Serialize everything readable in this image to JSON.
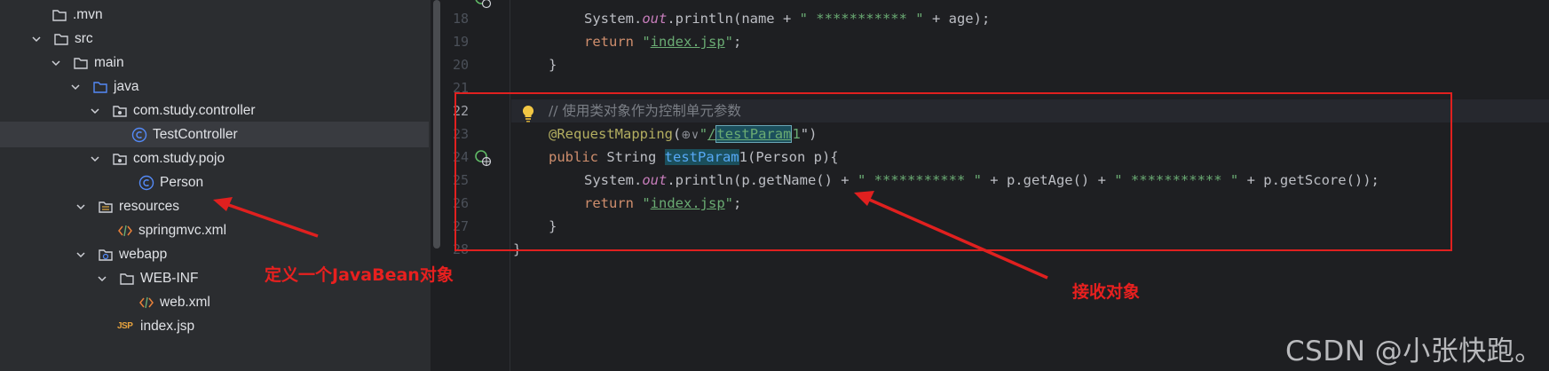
{
  "project_tree": {
    "rows": [
      {
        "label": ".mvn",
        "icon": "folder-icon"
      },
      {
        "label": "src",
        "icon": "folder-icon"
      },
      {
        "label": "main",
        "icon": "folder-icon"
      },
      {
        "label": "java",
        "icon": "source-folder-icon"
      },
      {
        "label": "com.study.controller",
        "icon": "package-icon"
      },
      {
        "label": "TestController",
        "icon": "class-icon"
      },
      {
        "label": "com.study.pojo",
        "icon": "package-icon"
      },
      {
        "label": "Person",
        "icon": "class-icon"
      },
      {
        "label": "resources",
        "icon": "resources-folder-icon"
      },
      {
        "label": "springmvc.xml",
        "icon": "xml-file-icon"
      },
      {
        "label": "webapp",
        "icon": "web-folder-icon"
      },
      {
        "label": "WEB-INF",
        "icon": "folder-icon"
      },
      {
        "label": "web.xml",
        "icon": "xml-file-icon"
      },
      {
        "label": "index.jsp",
        "icon": "jsp-file-icon",
        "badge": "JSP"
      }
    ],
    "selected": "TestController"
  },
  "editor": {
    "line_numbers": [
      "18",
      "19",
      "20",
      "21",
      "22",
      "23",
      "24",
      "25",
      "26",
      "27",
      "28"
    ],
    "active_line": "22",
    "code": {
      "l18": {
        "a": "System.",
        "b": "out",
        "c": ".println(name + ",
        "d": "\" *********** \"",
        "e": " + age);"
      },
      "l19": {
        "a": "return ",
        "b": "\"",
        "c": "index.jsp",
        "d": "\"",
        "e": ";"
      },
      "l20": "}",
      "l22": "// 使用类对象作为控制单元参数",
      "l23": {
        "a": "@RequestMapping",
        "b": "(",
        "c": "⊕∨",
        "d": "\"",
        "e": "/",
        "f": "testParam",
        "g": "1",
        "h": "\")"
      },
      "l24": {
        "a": "public ",
        "b": "String ",
        "c": "testParam",
        "d": "1(Person p){"
      },
      "l25": {
        "a": "System.",
        "b": "out",
        "c": ".println(p.getName() + ",
        "d": "\" *********** \"",
        "e": " + p.getAge() + ",
        "f": "\" *********** \"",
        "g": " + p.getScore());"
      },
      "l26": {
        "a": "return ",
        "b": "\"",
        "c": "index.jsp",
        "d": "\"",
        "e": ";"
      },
      "l27": "}",
      "l28": "}"
    }
  },
  "annotations": {
    "left_callout": "定义一个JavaBean对象",
    "right_callout": "接收对象"
  },
  "watermark": "CSDN @小张快跑。",
  "colors": {
    "annotation_red": "#e0201f",
    "keyword": "#cf8e6d",
    "string": "#6aab73",
    "annotation": "#b3ae60",
    "field": "#c77dbb"
  }
}
